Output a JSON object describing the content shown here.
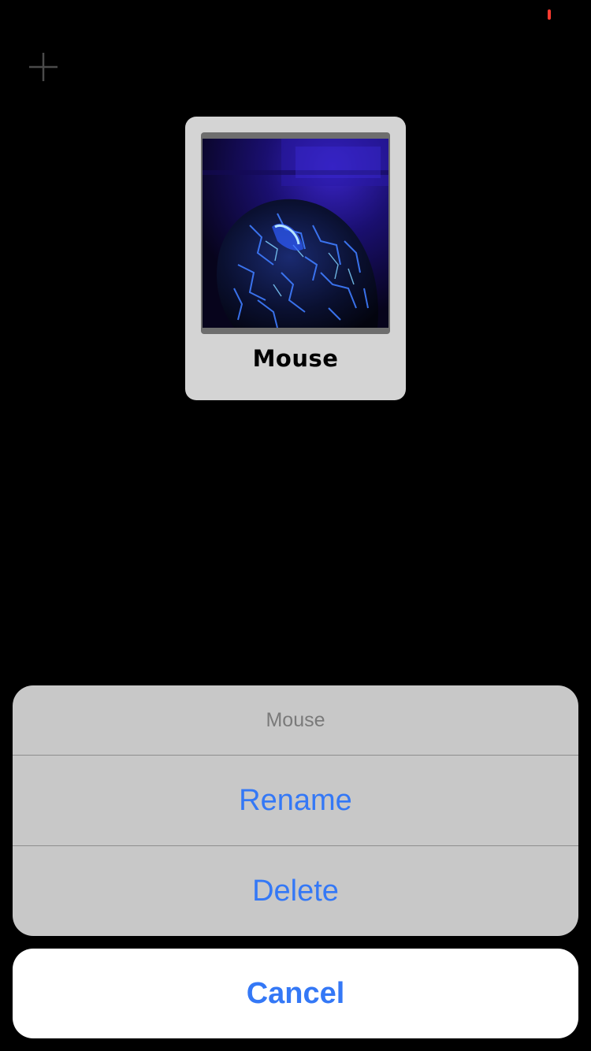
{
  "status": {
    "indicator_color": "#ff3b30"
  },
  "toolbar": {
    "add_icon": "plus-icon"
  },
  "card": {
    "label": "Mouse",
    "image_subject": "glowing-blue-computer-mouse"
  },
  "action_sheet": {
    "title": "Mouse",
    "actions": [
      {
        "label": "Rename"
      },
      {
        "label": "Delete"
      }
    ],
    "cancel_label": "Cancel"
  },
  "colors": {
    "accent": "#3478f6",
    "background": "#000000",
    "sheet": "#c8c8c8",
    "card": "#d4d4d4"
  }
}
